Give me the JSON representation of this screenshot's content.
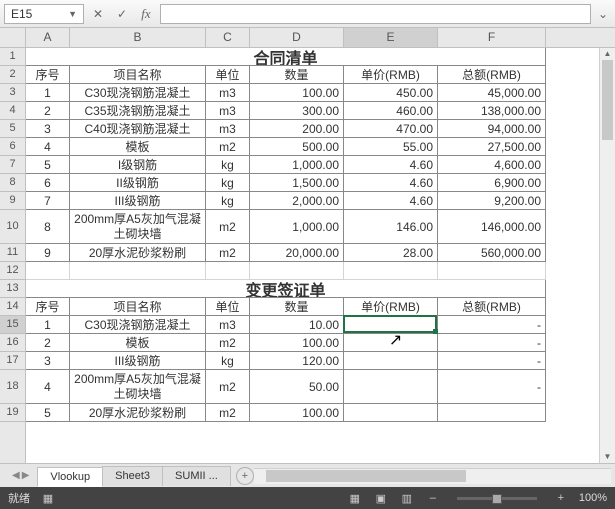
{
  "namebox": "E15",
  "fx_label": "fx",
  "cols": [
    {
      "k": "A",
      "w": 44
    },
    {
      "k": "B",
      "w": 136
    },
    {
      "k": "C",
      "w": 44
    },
    {
      "k": "D",
      "w": 94
    },
    {
      "k": "E",
      "w": 94,
      "sel": true
    },
    {
      "k": "F",
      "w": 108
    }
  ],
  "rows": [
    {
      "n": 1
    },
    {
      "n": 2
    },
    {
      "n": 3
    },
    {
      "n": 4
    },
    {
      "n": 5
    },
    {
      "n": 6
    },
    {
      "n": 7
    },
    {
      "n": 8
    },
    {
      "n": 9
    },
    {
      "n": 10,
      "tall": true
    },
    {
      "n": 11
    },
    {
      "n": 12
    },
    {
      "n": 13
    },
    {
      "n": 14
    },
    {
      "n": 15,
      "sel": true
    },
    {
      "n": 16
    },
    {
      "n": 17
    },
    {
      "n": 18,
      "tall": true
    },
    {
      "n": 19
    }
  ],
  "section1_title": "合同清单",
  "section2_title": "变更签证单",
  "headers": {
    "no": "序号",
    "name": "项目名称",
    "unit": "单位",
    "qty": "数量",
    "price": "单价(RMB)",
    "total": "总额(RMB)"
  },
  "t1": [
    {
      "no": "1",
      "name": "C30现浇钢筋混凝土",
      "unit": "m3",
      "qty": "100.00",
      "price": "450.00",
      "total": "45,000.00"
    },
    {
      "no": "2",
      "name": "C35现浇钢筋混凝土",
      "unit": "m3",
      "qty": "300.00",
      "price": "460.00",
      "total": "138,000.00"
    },
    {
      "no": "3",
      "name": "C40现浇钢筋混凝土",
      "unit": "m3",
      "qty": "200.00",
      "price": "470.00",
      "total": "94,000.00"
    },
    {
      "no": "4",
      "name": "模板",
      "unit": "m2",
      "qty": "500.00",
      "price": "55.00",
      "total": "27,500.00"
    },
    {
      "no": "5",
      "name": "I级钢筋",
      "unit": "kg",
      "qty": "1,000.00",
      "price": "4.60",
      "total": "4,600.00"
    },
    {
      "no": "6",
      "name": "II级钢筋",
      "unit": "kg",
      "qty": "1,500.00",
      "price": "4.60",
      "total": "6,900.00"
    },
    {
      "no": "7",
      "name": "III级钢筋",
      "unit": "kg",
      "qty": "2,000.00",
      "price": "4.60",
      "total": "9,200.00"
    },
    {
      "no": "8",
      "name": "200mm厚A5灰加气混凝土砌块墙",
      "unit": "m2",
      "qty": "1,000.00",
      "price": "146.00",
      "total": "146,000.00",
      "tall": true
    },
    {
      "no": "9",
      "name": "20厚水泥砂浆粉刷",
      "unit": "m2",
      "qty": "20,000.00",
      "price": "28.00",
      "total": "560,000.00"
    }
  ],
  "t2": [
    {
      "no": "1",
      "name": "C30现浇钢筋混凝土",
      "unit": "m3",
      "qty": "10.00",
      "price": "",
      "total": "-"
    },
    {
      "no": "2",
      "name": "模板",
      "unit": "m2",
      "qty": "100.00",
      "price": "",
      "total": "-"
    },
    {
      "no": "3",
      "name": "III级钢筋",
      "unit": "kg",
      "qty": "120.00",
      "price": "",
      "total": "-"
    },
    {
      "no": "4",
      "name": "200mm厚A5灰加气混凝土砌块墙",
      "unit": "m2",
      "qty": "50.00",
      "price": "",
      "total": "-",
      "tall": true
    },
    {
      "no": "5",
      "name": "20厚水泥砂浆粉刷",
      "unit": "m2",
      "qty": "100.00",
      "price": "",
      "total": ""
    }
  ],
  "tabs": [
    {
      "label": "Vlookup",
      "active": true
    },
    {
      "label": "Sheet3"
    },
    {
      "label": "SUMII ..."
    }
  ],
  "status": {
    "ready": "就绪",
    "zoom": "100%",
    "plus": "+",
    "minus": "–"
  }
}
